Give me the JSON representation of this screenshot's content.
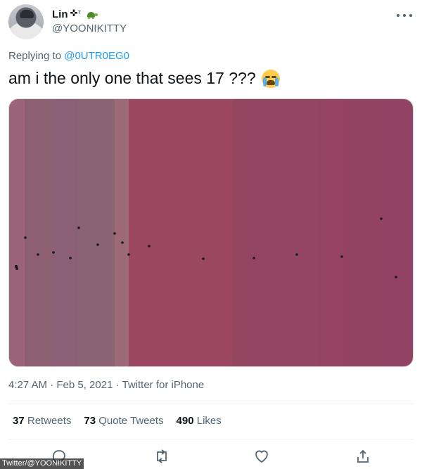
{
  "author": {
    "display_name": "Lin",
    "name_suffix": "✜⁷",
    "handle": "@YOONIKITTY"
  },
  "reply": {
    "prefix": "Replying to",
    "mention": "@0UTR0EG0"
  },
  "tweet": {
    "text": "am i the only one that sees 17 ???",
    "emoji": "loudly-crying-face"
  },
  "meta": {
    "time": "4:27 AM",
    "date": "Feb 5, 2021",
    "source": "Twitter for iPhone",
    "timestamp_line": "4:27 AM · Feb 5, 2021 · Twitter for iPhone"
  },
  "stats": {
    "retweets_count": "37",
    "retweets_label": "Retweets",
    "quotes_count": "73",
    "quotes_label": "Quote Tweets",
    "likes_count": "490",
    "likes_label": "Likes"
  },
  "actions": {
    "icons": [
      "reply-icon",
      "retweet-icon",
      "like-icon",
      "share-icon"
    ]
  },
  "watermark": "Twitter/@YOONIKITTY",
  "colors": {
    "accent": "#1d9bf0",
    "secondary_text": "#536471",
    "image_left": "#8a6378",
    "image_right": "#94445f"
  }
}
